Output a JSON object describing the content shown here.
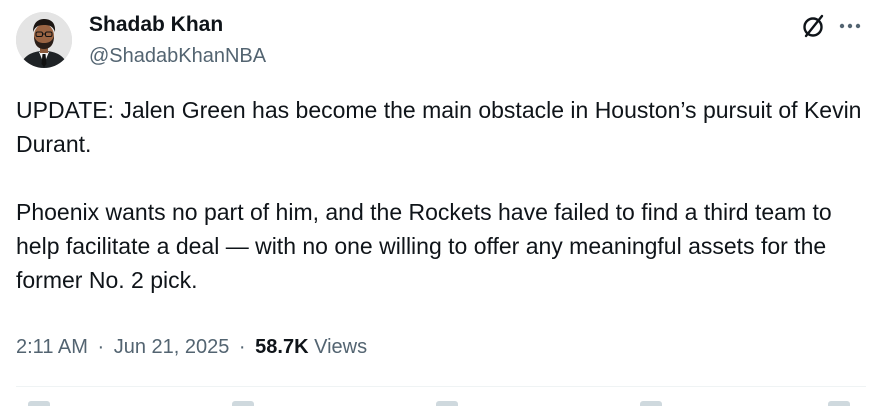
{
  "author": {
    "name": "Shadab Khan",
    "handle": "@ShadabKhanNBA"
  },
  "icons": {
    "grok": "grok-icon",
    "more": "more-options-icon"
  },
  "tweet": {
    "paragraphs": [
      "UPDATE: Jalen Green has become the main obstacle in Houston’s pursuit of Kevin Durant.",
      "Phoenix wants no part of him, and the Rockets have failed to find a third team to help facilitate a deal — with no one willing to offer any meaningful assets for the former No. 2 pick."
    ]
  },
  "meta": {
    "time": "2:11 AM",
    "separator": "·",
    "date": "Jun 21, 2025",
    "views_count": "58.7K",
    "views_label": "Views"
  },
  "colors": {
    "text_primary": "#0f1419",
    "text_secondary": "#536471",
    "divider": "#eff3f4"
  }
}
